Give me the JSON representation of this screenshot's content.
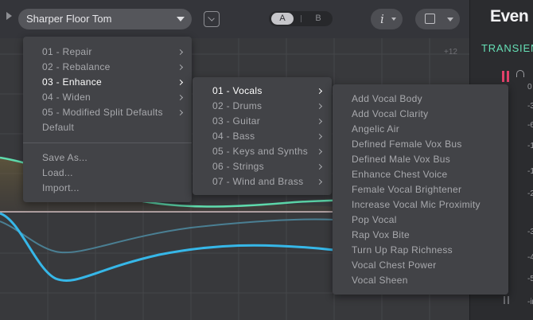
{
  "topbar": {
    "preset_name": "Sharper Floor Tom",
    "ab_a": "A",
    "ab_b": "B",
    "info_label": "i"
  },
  "right_panel": {
    "brand": "Even",
    "section": "TRANSIEN",
    "meter_labels": [
      "0",
      "-3",
      "-6",
      "-1",
      "-1",
      "-2",
      "-3",
      "-4",
      "-5",
      "-in"
    ]
  },
  "eq": {
    "scale_top": "+12",
    "curve_colors": {
      "teal": "#5fdcae",
      "blue": "#36b7e8"
    }
  },
  "menu1": {
    "items": [
      {
        "label": "01 - Repair",
        "submenu": true,
        "active": false
      },
      {
        "label": "02 - Rebalance",
        "submenu": true,
        "active": false
      },
      {
        "label": "03 - Enhance",
        "submenu": true,
        "active": true
      },
      {
        "label": "04 - Widen",
        "submenu": true,
        "active": false
      },
      {
        "label": "05 - Modified Split Defaults",
        "submenu": true,
        "active": false
      },
      {
        "label": "Default",
        "submenu": false,
        "active": false
      }
    ],
    "actions": [
      "Save As...",
      "Load...",
      "Import..."
    ]
  },
  "menu2": {
    "items": [
      {
        "label": "01 - Vocals",
        "active": true
      },
      {
        "label": "02 - Drums",
        "active": false
      },
      {
        "label": "03 - Guitar",
        "active": false
      },
      {
        "label": "04 - Bass",
        "active": false
      },
      {
        "label": "05 - Keys and Synths",
        "active": false
      },
      {
        "label": "06 - Strings",
        "active": false
      },
      {
        "label": "07 - Wind and Brass",
        "active": false
      }
    ]
  },
  "menu3": {
    "items": [
      "Add Vocal Body",
      "Add Vocal Clarity",
      "Angelic Air",
      "Defined Female Vox Bus",
      "Defined Male Vox Bus",
      "Enhance Chest Voice",
      "Female Vocal Brightener",
      "Increase Vocal Mic Proximity",
      "Pop Vocal",
      "Rap Vox Bite",
      "Turn Up Rap Richness",
      "Vocal Chest Power",
      "Vocal Sheen"
    ]
  }
}
